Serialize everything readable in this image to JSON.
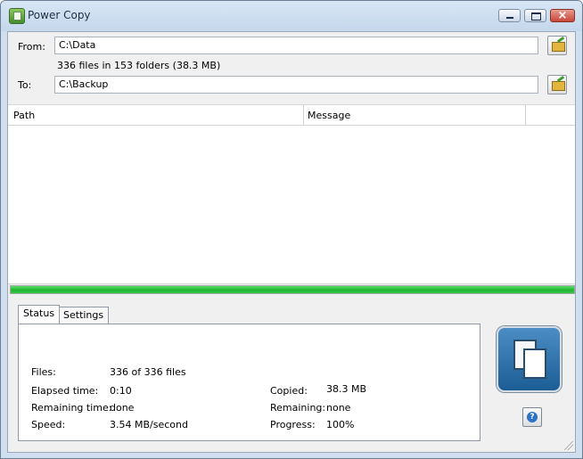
{
  "window": {
    "title": "Power Copy",
    "icon": "app-copy-icon"
  },
  "form": {
    "from_label": "From:",
    "from_value": "C:\\Data",
    "summary": "336 files in 153 folders (38.3 MB)",
    "to_label": "To:",
    "to_value": "C:\\Backup"
  },
  "list": {
    "columns": [
      "Path",
      "Message"
    ]
  },
  "progress": {
    "value": 1
  },
  "tabs": [
    "Status",
    "Settings"
  ],
  "status": {
    "files_label": "Files:",
    "files_value": "336 of 336 files",
    "elapsed_label": "Elapsed time:",
    "elapsed_value": "0:10",
    "remaining_time_label": "Remaining time:",
    "remaining_time_value": "done",
    "speed_label": "Speed:",
    "speed_value": "3.54 MB/second",
    "copied_label": "Copied:",
    "copied_value": "38.3 MB",
    "remaining_label": "Remaining:",
    "remaining_value": "none",
    "progress_label": "Progress:",
    "progress_value": "100%"
  },
  "colors": {
    "progress_fill": "#21b431",
    "copy_button": "#1d5d95",
    "help_icon": "#2c73c5"
  }
}
